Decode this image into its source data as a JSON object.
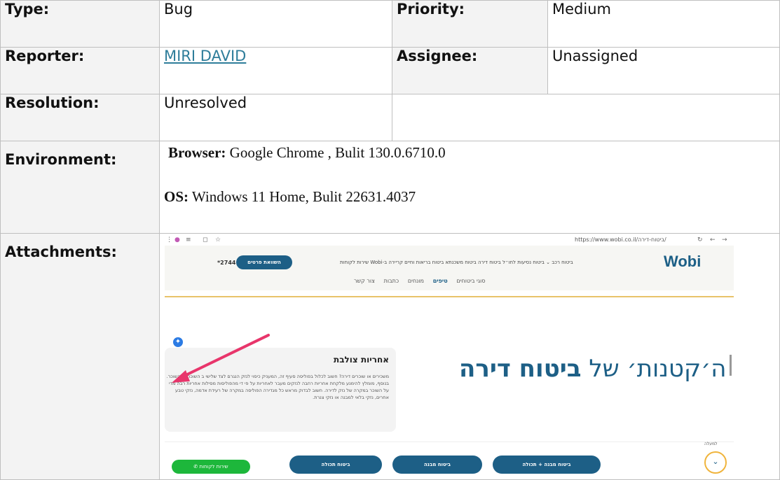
{
  "issue": {
    "type_label": "Type:",
    "type_value": "Bug",
    "priority_label": "Priority:",
    "priority_value": "Medium",
    "reporter_label": "Reporter:",
    "reporter_value": "MIRI DAVID",
    "assignee_label": "Assignee:",
    "assignee_value": "Unassigned",
    "resolution_label": "Resolution:",
    "resolution_value": "Unresolved",
    "environment_label": "Environment:",
    "env_browser_label": "Browser:",
    "env_browser_value": " Google Chrome , Bulit 130.0.6710.0",
    "env_os_label": "OS:",
    "env_os_value": " Windows 11 Home, Bulit 22631.4037",
    "attachments_label": "Attachments:"
  },
  "attachment": {
    "url": "https://www.wobi.co.il/ביטוח-דירה/",
    "logo": "Wobi",
    "nav": "ביטוח רכב ⌄  ביטוח נסיעות לחו״ל  ביטוח דירה  ביטוח משכנתא  ביטוח בריאות וחיים  קריירה ב-Wobi  שירות לקוחות",
    "compare_button": "השוואת פרטים",
    "phone": "*2744",
    "subnav_items": [
      "סוגי ביטוחים",
      "טיפים",
      "מונחים",
      "כתבות",
      "צור קשר"
    ],
    "hero_regular": "ה׳קטנות׳ של ",
    "hero_bold": "ביטוח דירה",
    "card_title": "אחריות צולבת",
    "card_text": "משכירים או שוכרים דירה? חשוב לכלול בפוליסה סעיף זה, המעניק כיסוי לנזק הנגרם לצד שלישי ב השוכר או השוכר. בנוסף, מומלץ להימנע מלקחת אחריות רחבה לנזקים מעבר לאחריות על פי די מהפוליסות מסילות אחריות רבה מדי על השוכר במקרה של נזק לדירה. חשוב לבדוק מראש כל מגדירה הפוליסה במקרה של רעידת אדמה, נזקי טבע אחרים, נזקי בלאי למבנה או נזקי צנרת.",
    "buttons": [
      "ביטוח מבנה + תכולה",
      "ביטוח מבנה",
      "ביטוח תכולה"
    ],
    "whatsapp": "שירות לקוחות",
    "to_top": "למעלה",
    "accent": "#1d5f86",
    "arrow_color": "#e8356b"
  }
}
